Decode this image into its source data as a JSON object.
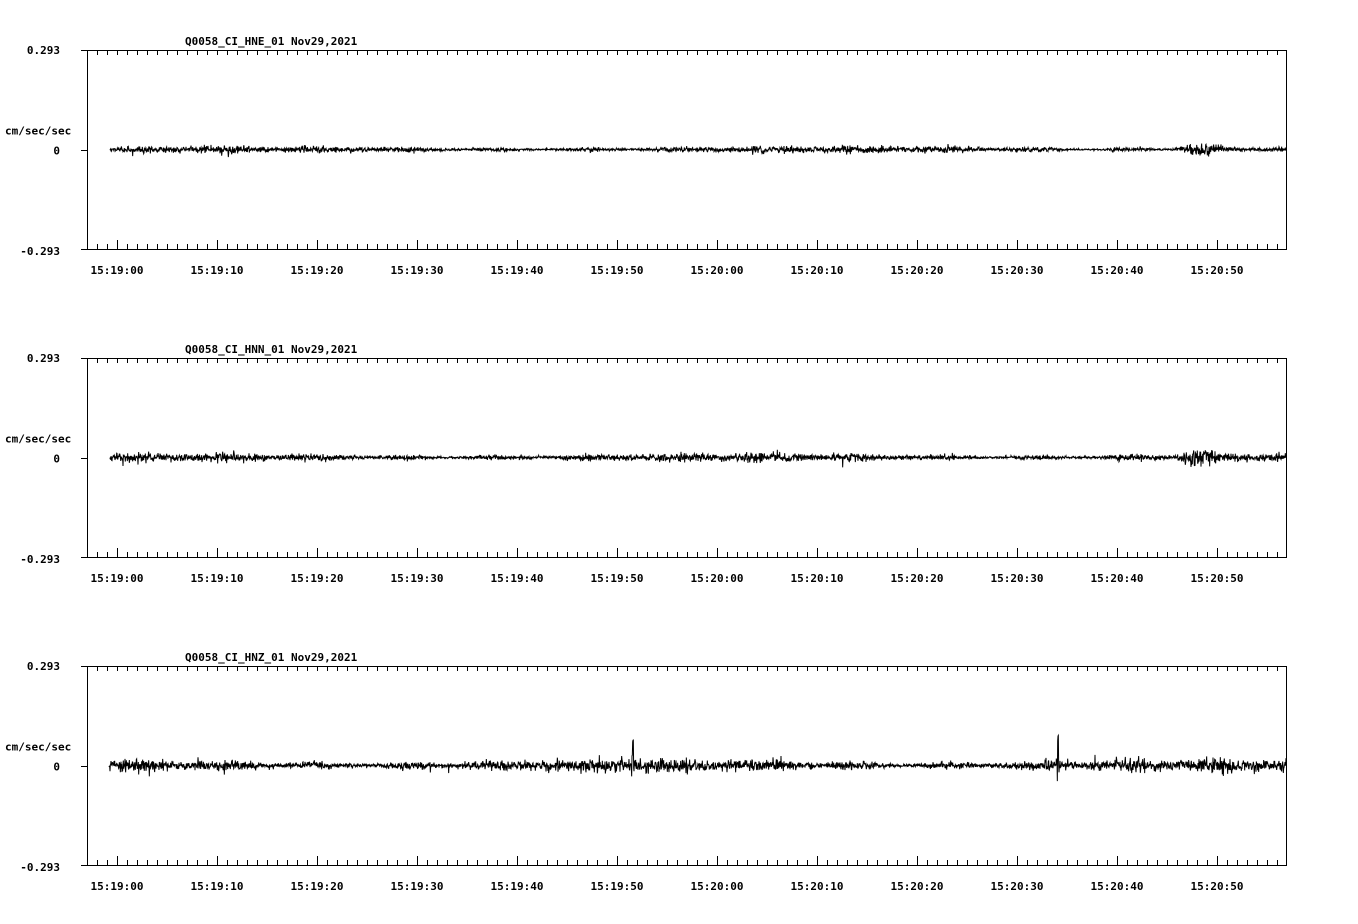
{
  "chart_data": [
    {
      "type": "line",
      "title": "Q0058_CI_HNE_01  Nov29,2021",
      "ylabel": "cm/sec/sec",
      "ylim": [
        -0.293,
        0.293
      ],
      "y_ticks": [
        "0.293",
        "0",
        "-0.293"
      ],
      "x_tick_labels": [
        "15:19:00",
        "15:19:10",
        "15:19:20",
        "15:19:30",
        "15:19:40",
        "15:19:50",
        "15:20:00",
        "15:20:10",
        "15:20:20",
        "15:20:30",
        "15:20:40",
        "15:20:50"
      ],
      "x_range_sec": [
        -1.3,
        57.7
      ],
      "trace_start_sec": -0.7,
      "noise_amplitude": 0.013,
      "events": [
        {
          "t_sec": 108.2,
          "amplitude": 0.09,
          "width_sec": 1.6
        }
      ]
    },
    {
      "type": "line",
      "title": "Q0058_CI_HNN_01  Nov29,2021",
      "ylabel": "cm/sec/sec",
      "ylim": [
        -0.293,
        0.293
      ],
      "y_ticks": [
        "0.293",
        "0",
        "-0.293"
      ],
      "x_tick_labels": [
        "15:19:00",
        "15:19:10",
        "15:19:20",
        "15:19:30",
        "15:19:40",
        "15:19:50",
        "15:20:00",
        "15:20:10",
        "15:20:20",
        "15:20:30",
        "15:20:40",
        "15:20:50"
      ],
      "x_range_sec": [
        -1.3,
        57.7
      ],
      "trace_start_sec": -0.7,
      "noise_amplitude": 0.016,
      "events": [
        {
          "t_sec": 108.3,
          "amplitude": 0.095,
          "width_sec": 1.6
        }
      ]
    },
    {
      "type": "line",
      "title": "Q0058_CI_HNZ_01  Nov29,2021",
      "ylabel": "cm/sec/sec",
      "ylim": [
        -0.293,
        0.293
      ],
      "y_ticks": [
        "0.293",
        "0",
        "-0.293"
      ],
      "x_tick_labels": [
        "15:19:00",
        "15:19:10",
        "15:19:20",
        "15:19:30",
        "15:19:40",
        "15:19:50",
        "15:20:00",
        "15:20:10",
        "15:20:20",
        "15:20:30",
        "15:20:40",
        "15:20:50"
      ],
      "x_range_sec": [
        -1.3,
        57.7
      ],
      "trace_start_sec": -0.8,
      "noise_amplitude": 0.025,
      "events": [
        {
          "t_sec": 51.6,
          "amplitude": 0.11,
          "width_sec": 0.15
        },
        {
          "t_sec": 94.1,
          "amplitude": 0.13,
          "width_sec": 0.15
        }
      ]
    }
  ]
}
